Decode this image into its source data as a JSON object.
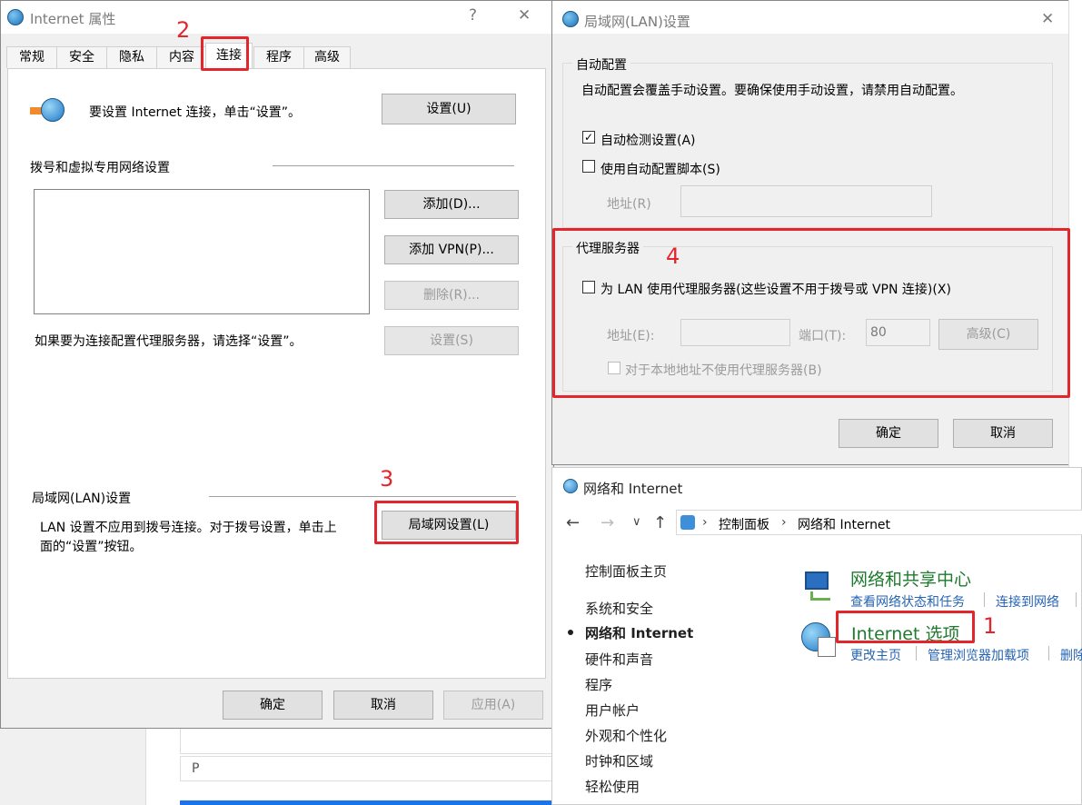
{
  "ie_dialog": {
    "title": "Internet 属性",
    "help": "?",
    "close": "✕",
    "tabs": [
      "常规",
      "安全",
      "隐私",
      "内容",
      "连接",
      "程序",
      "高级"
    ],
    "setup_text": "要设置 Internet 连接，单击“设置”。",
    "setup_button": "设置(U)",
    "dialup_heading": "拨号和虚拟专用网络设置",
    "add_button": "添加(D)...",
    "add_vpn_button": "添加 VPN(P)...",
    "remove_button": "删除(R)...",
    "settings_button": "设置(S)",
    "proxy_hint": "如果要为连接配置代理服务器，请选择“设置”。",
    "lan_heading": "局域网(LAN)设置",
    "lan_text_line1": "LAN 设置不应用到拨号连接。对于拨号设置，单击上",
    "lan_text_line2": "面的“设置”按钮。",
    "lan_button": "局域网设置(L)",
    "ok_button": "确定",
    "cancel_button": "取消",
    "apply_button": "应用(A)"
  },
  "lan_dialog": {
    "title": "局域网(LAN)设置",
    "close": "✕",
    "auto_config_heading": "自动配置",
    "auto_config_desc": "自动配置会覆盖手动设置。要确保使用手动设置，请禁用自动配置。",
    "auto_detect_label": "自动检测设置(A)",
    "auto_detect_checked": true,
    "use_script_label": "使用自动配置脚本(S)",
    "use_script_checked": false,
    "script_address_label": "地址(R)",
    "proxy_heading": "代理服务器",
    "use_proxy_label": "为 LAN 使用代理服务器(这些设置不用于拨号或 VPN 连接)(X)",
    "use_proxy_checked": false,
    "address_label": "地址(E):",
    "port_label": "端口(T):",
    "port_value": "80",
    "advanced_button": "高级(C)",
    "bypass_local_label": "对于本地地址不使用代理服务器(B)",
    "ok_button": "确定",
    "cancel_button": "取消"
  },
  "control_panel": {
    "title": "网络和 Internet",
    "nav_back": "←",
    "nav_forward": "→",
    "nav_down": "∨",
    "nav_up": "↑",
    "breadcrumb": [
      "控制面板",
      "网络和 Internet"
    ],
    "sidebar_home": "控制面板主页",
    "sidebar_items": [
      "系统和安全",
      "网络和 Internet",
      "硬件和声音",
      "程序",
      "用户帐户",
      "外观和个性化",
      "时钟和区域",
      "轻松使用"
    ],
    "active_item": "网络和 Internet",
    "network_center_title": "网络和共享中心",
    "network_center_links": [
      "查看网络状态和任务",
      "连接到网络"
    ],
    "internet_options_title": "Internet 选项",
    "internet_options_links": [
      "更改主页",
      "管理浏览器加载项",
      "删除"
    ]
  },
  "background": {
    "p_label": "P"
  },
  "annotations": [
    "1",
    "2",
    "3",
    "4"
  ],
  "colors": {
    "highlight_red": "#e3262c",
    "link_blue": "#2563b5",
    "cp_title_green": "#1e7a2e"
  }
}
